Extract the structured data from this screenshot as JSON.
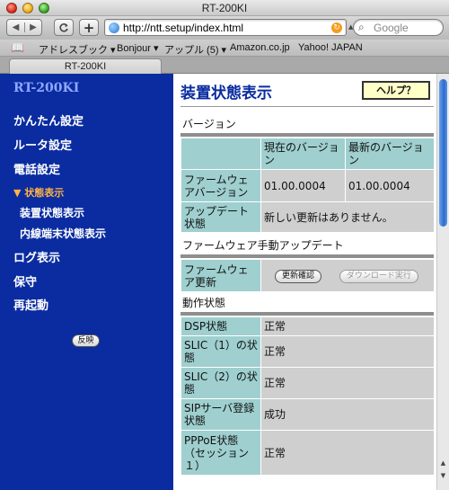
{
  "window": {
    "title": "RT-200KI"
  },
  "toolbar": {
    "back_glyph": "◀",
    "forward_glyph": "▶",
    "reload_glyph": "C",
    "add_glyph": "+",
    "url": "http://ntt.setup/index.html",
    "search_placeholder": "Google"
  },
  "bookmarks": [
    {
      "label": "アドレスブック ▾"
    },
    {
      "label": "Bonjour ▾"
    },
    {
      "label": "アップル (5) ▾"
    },
    {
      "label": "Amazon.co.jp"
    },
    {
      "label": "Yahoo! JAPAN"
    }
  ],
  "tab": {
    "label": "RT-200KI"
  },
  "sidebar": {
    "title": "RT-200KI",
    "items": [
      {
        "label": "かんたん設定"
      },
      {
        "label": "ルータ設定"
      },
      {
        "label": "電話設定"
      },
      {
        "label": "▼ 状態表示"
      },
      {
        "label": "装置状態表示"
      },
      {
        "label": "内線端末状態表示"
      },
      {
        "label": "ログ表示"
      },
      {
        "label": "保守"
      },
      {
        "label": "再起動"
      }
    ],
    "apply_button": "反映"
  },
  "main": {
    "title": "装置状態表示",
    "help_button": "ヘルプ？",
    "version": {
      "section_label": "バージョン",
      "header_current": "現在のバージョン",
      "header_latest": "最新のバージョン",
      "firmware_label": "ファームウェアバージョン",
      "current_value": "01.00.0004",
      "latest_value": "01.00.0004",
      "update_label": "アップデート状態",
      "update_value": "新しい更新はありません。"
    },
    "manual_update": {
      "section_label": "ファームウェア手動アップデート",
      "row_label": "ファームウェア更新",
      "check_button": "更新確認",
      "download_button": "ダウンロード実行"
    },
    "operation": {
      "section_label": "動作状態",
      "rows": [
        {
          "label": "DSP状態",
          "value": "正常"
        },
        {
          "label": "SLIC（1）の状態",
          "value": "正常"
        },
        {
          "label": "SLIC（2）の状態",
          "value": "正常"
        },
        {
          "label": "SIPサーバ登録状態",
          "value": "成功"
        },
        {
          "label": "PPPoE状態（セッション１）",
          "value": "正常"
        }
      ]
    }
  }
}
